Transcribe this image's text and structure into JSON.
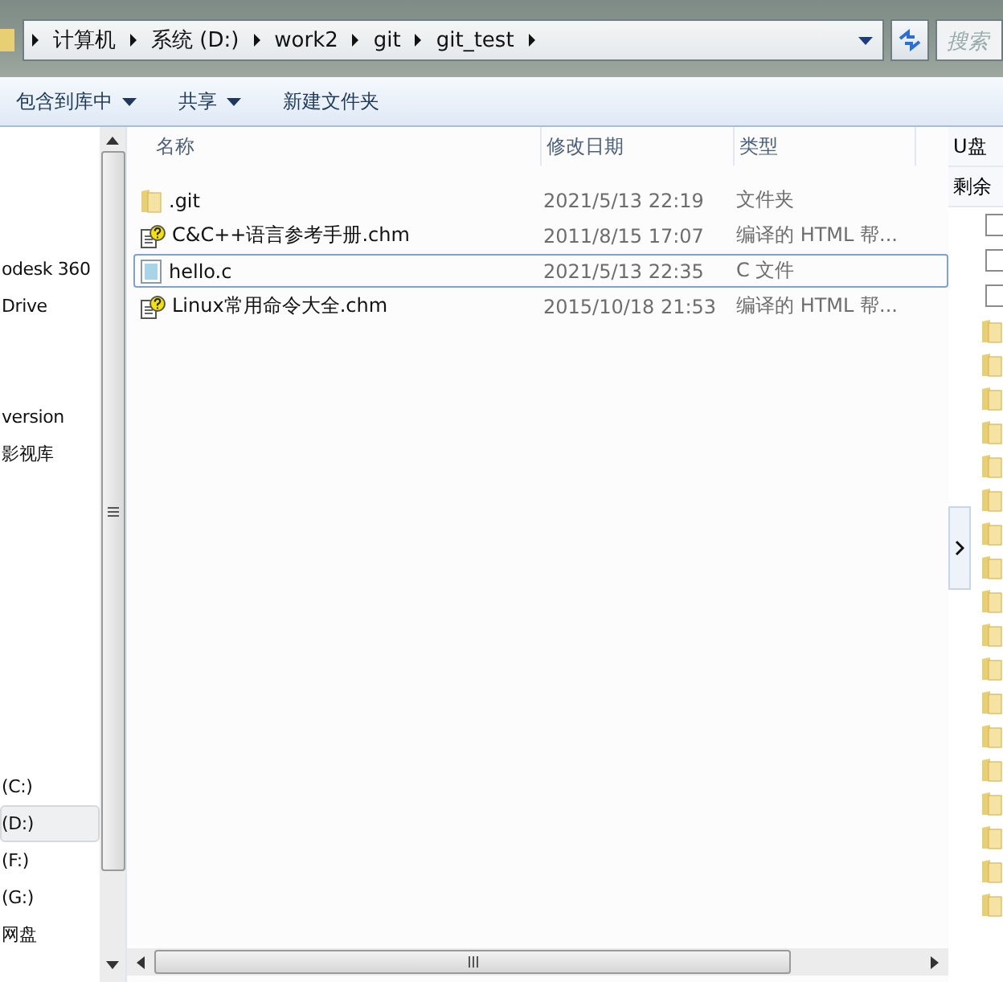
{
  "address_bar": {
    "crumbs": [
      "计算机",
      "系统 (D:)",
      "work2",
      "git",
      "git_test"
    ],
    "search_placeholder": "搜索"
  },
  "toolbar": {
    "buttons": [
      {
        "label": "包含到库中",
        "dropdown": true
      },
      {
        "label": "共享",
        "dropdown": true
      },
      {
        "label": "新建文件夹",
        "dropdown": false
      }
    ]
  },
  "nav": {
    "items": [
      {
        "label": "odesk 360",
        "selected": false
      },
      {
        "label": "Drive",
        "selected": false
      },
      {
        "label": "version",
        "selected": false
      },
      {
        "label": "影视库",
        "selected": false
      },
      {
        "label": "(C:)",
        "selected": false
      },
      {
        "label": "(D:)",
        "selected": true
      },
      {
        "label": "(F:)",
        "selected": false
      },
      {
        "label": "(G:)",
        "selected": false
      },
      {
        "label": "网盘",
        "selected": false
      }
    ]
  },
  "file_list": {
    "columns": [
      "名称",
      "修改日期",
      "类型"
    ],
    "rows": [
      {
        "kind": "folder",
        "name": ".git",
        "modified": "2021/5/13 22:19",
        "type": "文件夹",
        "focused": false
      },
      {
        "kind": "help",
        "name": "C&C++语言参考手册.chm",
        "modified": "2011/8/15 17:07",
        "type": "编译的 HTML 帮...",
        "focused": false
      },
      {
        "kind": "source",
        "name": "hello.c",
        "modified": "2021/5/13 22:35",
        "type": "C 文件",
        "focused": true
      },
      {
        "kind": "help",
        "name": "Linux常用命令大全.chm",
        "modified": "2015/10/18 21:53",
        "type": "编译的 HTML 帮...",
        "focused": false
      }
    ]
  },
  "side_panel": {
    "title": "U盘",
    "subtitle": "剩余",
    "checkboxes": [
      {
        "checked": false
      },
      {
        "checked": false
      },
      {
        "checked": false
      }
    ]
  }
}
